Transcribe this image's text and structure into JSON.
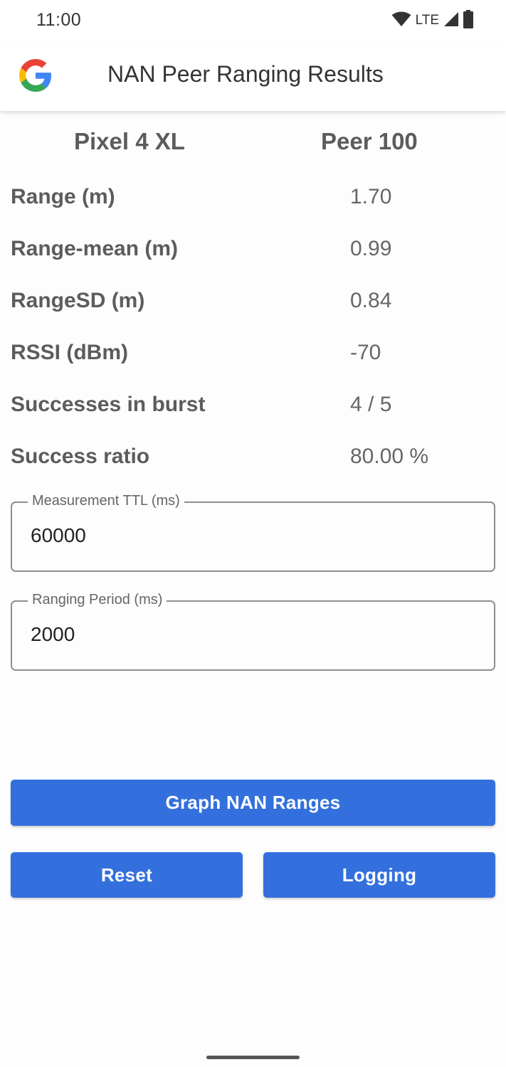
{
  "status_bar": {
    "time": "11:00",
    "network": "LTE",
    "icons": [
      "wifi-icon",
      "cell-signal-icon",
      "battery-icon"
    ]
  },
  "app_bar": {
    "title": "NAN Peer Ranging Results",
    "logo": "google-logo"
  },
  "header": {
    "device": "Pixel 4 XL",
    "peer": "Peer 100"
  },
  "metrics": [
    {
      "label": "Range (m)",
      "value": "1.70"
    },
    {
      "label": "Range-mean (m)",
      "value": "0.99"
    },
    {
      "label": "RangeSD (m)",
      "value": "0.84"
    },
    {
      "label": "RSSI (dBm)",
      "value": "-70"
    },
    {
      "label": "Successes in burst",
      "value": "4 / 5"
    },
    {
      "label": "Success ratio",
      "value": "80.00 %"
    }
  ],
  "fields": {
    "measurement_ttl": {
      "label": "Measurement TTL (ms)",
      "value": "60000"
    },
    "ranging_period": {
      "label": "Ranging Period (ms)",
      "value": "2000"
    }
  },
  "buttons": {
    "graph": "Graph NAN Ranges",
    "reset": "Reset",
    "logging": "Logging"
  },
  "colors": {
    "accent": "#3370dd",
    "text": "#5c5c5c"
  }
}
